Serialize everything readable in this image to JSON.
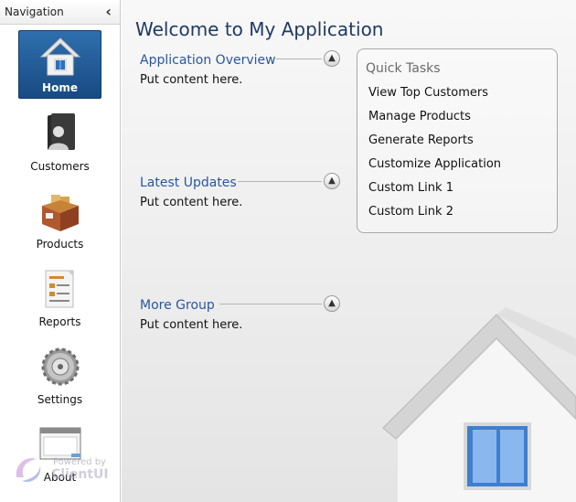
{
  "sidebar": {
    "header": "Navigation",
    "collapse_icon": "chevron-left-icon",
    "items": [
      {
        "label": "Home",
        "icon": "home-icon",
        "active": true
      },
      {
        "label": "Customers",
        "icon": "customers-icon"
      },
      {
        "label": "Products",
        "icon": "products-box-icon"
      },
      {
        "label": "Reports",
        "icon": "reports-icon"
      },
      {
        "label": "Settings",
        "icon": "gear-icon"
      },
      {
        "label": "About",
        "icon": "about-window-icon"
      }
    ],
    "powered_by": {
      "line1": "Powered by",
      "line2": "ClientUI"
    }
  },
  "main": {
    "title": "Welcome to My Application",
    "groups": [
      {
        "title": "Application Overview",
        "content": "Put content here."
      },
      {
        "title": "Latest Updates",
        "content": "Put content here."
      },
      {
        "title": "More Group",
        "content": "Put content here."
      }
    ],
    "quick_tasks": {
      "title": "Quick Tasks",
      "links": [
        "View Top Customers",
        "Manage Products",
        "Generate Reports",
        "Customize Application",
        "Custom Link 1",
        "Custom Link 2"
      ]
    }
  },
  "colors": {
    "accent": "#1f3a64",
    "group_title": "#2a56a0",
    "active_nav": "#2561a0"
  }
}
